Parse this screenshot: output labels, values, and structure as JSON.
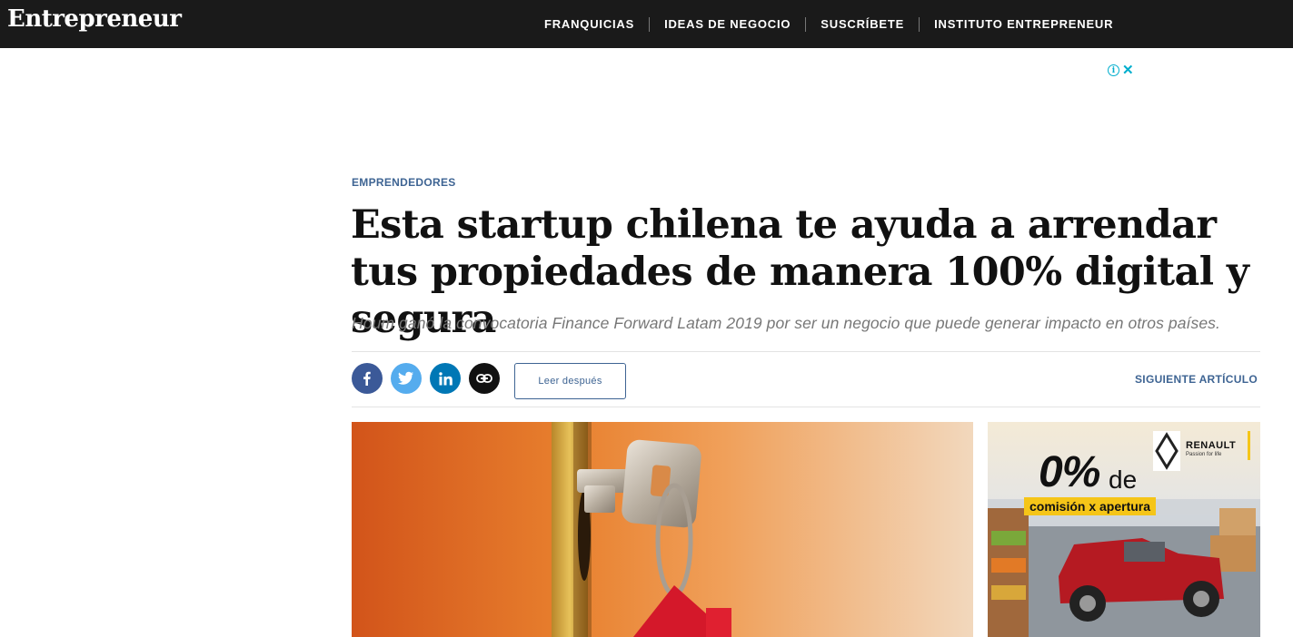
{
  "header": {
    "logo": "Entrepreneur",
    "nav": [
      "FRANQUICIAS",
      "IDEAS DE NEGOCIO",
      "SUSCRÍBETE",
      "INSTITUTO ENTREPRENEUR"
    ]
  },
  "ad_controls": {
    "info": "i",
    "close": "✕"
  },
  "article": {
    "category": "EMPRENDEDORES",
    "headline": "Esta startup chilena te ayuda a arrendar tus propiedades de manera 100% digital y segura",
    "subheadline": "Houm ganó la convocatoria Finance Forward Latam 2019 por ser un negocio que puede generar impacto en otros países.",
    "share_icons": [
      "facebook-icon",
      "twitter-icon",
      "linkedin-icon",
      "link-icon"
    ],
    "read_later": "Leer después",
    "next_article": "SIGUIENTE ARTÍCULO"
  },
  "side_ad": {
    "percent": "0%",
    "de": "de",
    "commission": "comisión x apertura",
    "brand": "RENAULT",
    "tagline": "Passion for life"
  },
  "colors": {
    "topbar": "#1a1a1a",
    "accent": "#3e6493",
    "facebook": "#3b5998",
    "twitter": "#55acee",
    "linkedin": "#0077b5",
    "ad_yellow": "#f5c518"
  }
}
